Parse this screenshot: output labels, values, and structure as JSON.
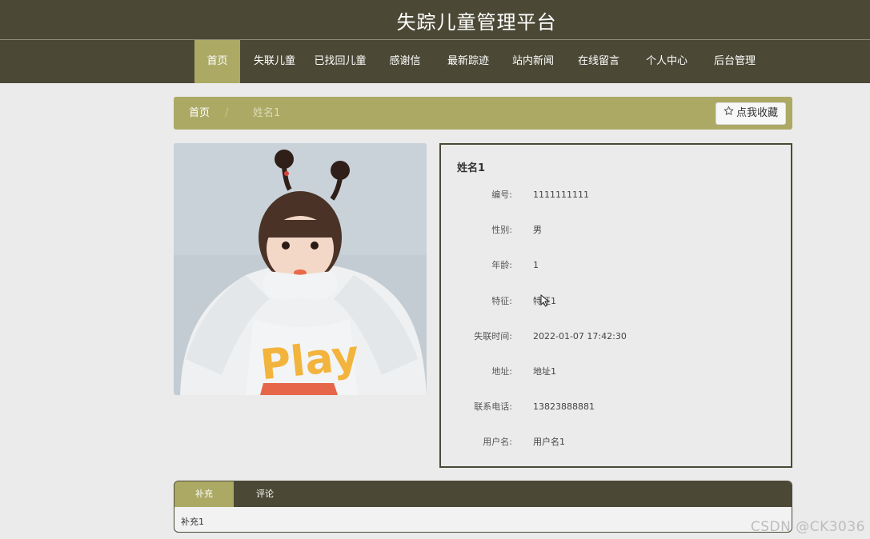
{
  "header": {
    "title": "失踪儿童管理平台"
  },
  "nav": {
    "items": [
      {
        "label": "首页",
        "active": true
      },
      {
        "label": "失联儿童",
        "active": false
      },
      {
        "label": "已找回儿童",
        "active": false
      },
      {
        "label": "感谢信",
        "active": false
      },
      {
        "label": "最新踪迹",
        "active": false
      },
      {
        "label": "站内新闻",
        "active": false
      },
      {
        "label": "在线留言",
        "active": false
      },
      {
        "label": "个人中心",
        "active": false
      },
      {
        "label": "后台管理",
        "active": false
      }
    ]
  },
  "breadcrumb": {
    "home": "首页",
    "separator": "/",
    "current": "姓名1",
    "favorite_label": "点我收藏",
    "favorite_icon": "star-outline-icon"
  },
  "detail": {
    "name": "姓名1",
    "fields": [
      {
        "label": "编号:",
        "value": "1111111111"
      },
      {
        "label": "性别:",
        "value": "男"
      },
      {
        "label": "年龄:",
        "value": "1"
      },
      {
        "label": "特征:",
        "value": "特征1"
      },
      {
        "label": "失联时间:",
        "value": "2022-01-07 17:42:30"
      },
      {
        "label": "地址:",
        "value": "地址1"
      },
      {
        "label": "联系电话:",
        "value": "13823888881"
      },
      {
        "label": "用户名:",
        "value": "用户名1"
      }
    ]
  },
  "tabs": {
    "items": [
      {
        "label": "补充",
        "active": true
      },
      {
        "label": "评论",
        "active": false
      }
    ],
    "content": "补充1"
  },
  "watermark": "CSDN @CK3036",
  "colors": {
    "header_bg": "#4b4936",
    "accent": "#aca965",
    "page_bg": "#ebebeb"
  }
}
